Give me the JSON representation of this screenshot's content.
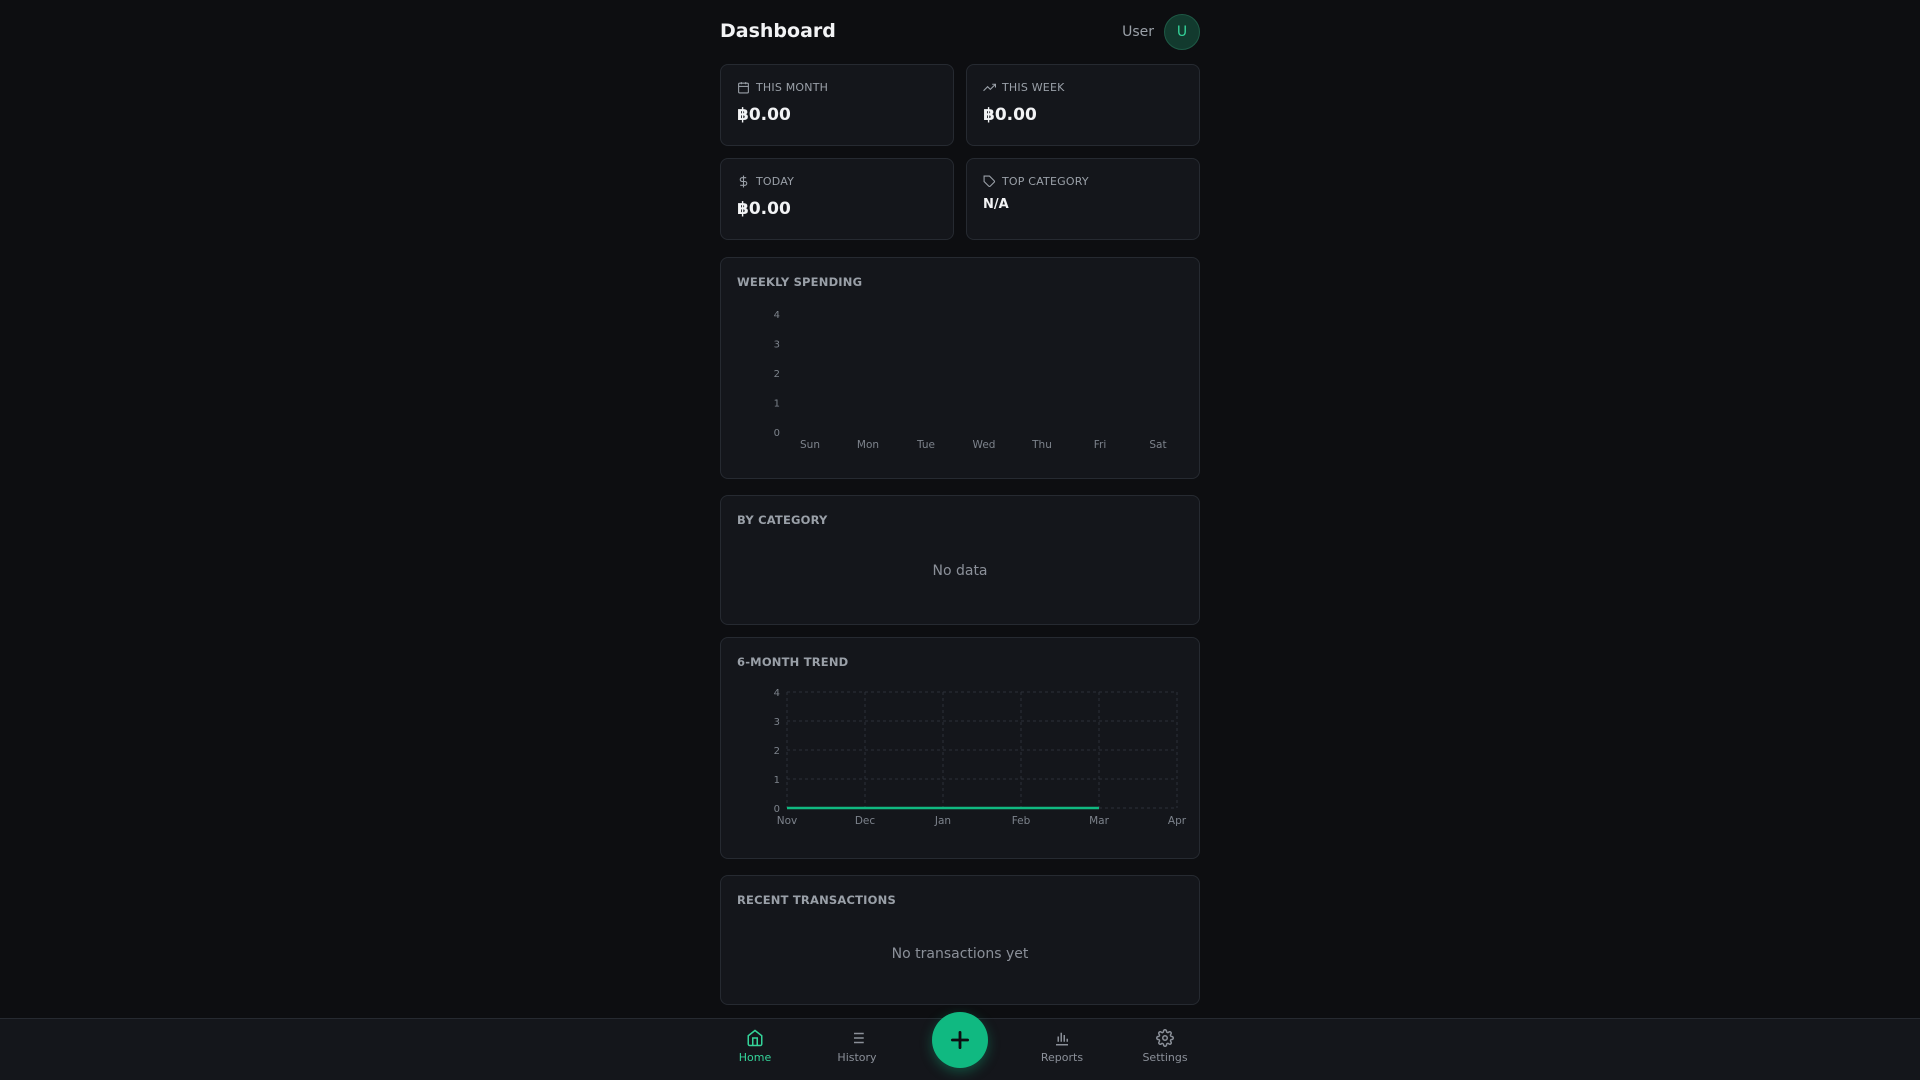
{
  "header": {
    "title": "Dashboard",
    "user_name": "User",
    "avatar_initial": "U"
  },
  "stats": [
    {
      "label": "THIS MONTH",
      "value": "฿0.00",
      "icon": "calendar-icon"
    },
    {
      "label": "THIS WEEK",
      "value": "฿0.00",
      "icon": "trending-up-icon"
    },
    {
      "label": "TODAY",
      "value": "฿0.00",
      "icon": "dollar-icon"
    },
    {
      "label": "TOP CATEGORY",
      "value": "N/A",
      "icon": "tag-icon"
    }
  ],
  "weekly": {
    "title": "WEEKLY SPENDING",
    "chart_data": {
      "type": "bar",
      "categories": [
        "Sun",
        "Mon",
        "Tue",
        "Wed",
        "Thu",
        "Fri",
        "Sat"
      ],
      "values": [
        0,
        0,
        0,
        0,
        0,
        0,
        0
      ],
      "yticks": [
        "0",
        "1",
        "2",
        "3",
        "4"
      ],
      "ylim": [
        0,
        4
      ]
    }
  },
  "category": {
    "title": "BY CATEGORY",
    "empty": "No data"
  },
  "trend": {
    "title": "6-MONTH TREND",
    "chart_data": {
      "type": "line",
      "categories": [
        "Nov",
        "Dec",
        "Jan",
        "Feb",
        "Mar",
        "Apr"
      ],
      "values": [
        0,
        0,
        0,
        0,
        0
      ],
      "yticks": [
        "0",
        "1",
        "2",
        "3",
        "4"
      ],
      "ylim": [
        0,
        4
      ],
      "grid": true,
      "line_color": "#10b981"
    }
  },
  "recent": {
    "title": "RECENT TRANSACTIONS",
    "empty": "No transactions yet"
  },
  "nav": {
    "items": [
      {
        "label": "Home",
        "icon": "home-icon"
      },
      {
        "label": "History",
        "icon": "list-icon"
      },
      {
        "label": "Reports",
        "icon": "bar-chart-icon"
      },
      {
        "label": "Settings",
        "icon": "gear-icon"
      }
    ],
    "fab_icon": "plus-icon"
  },
  "colors": {
    "accent": "#10b981",
    "background": "#0d0e11",
    "card": "#14161b"
  }
}
